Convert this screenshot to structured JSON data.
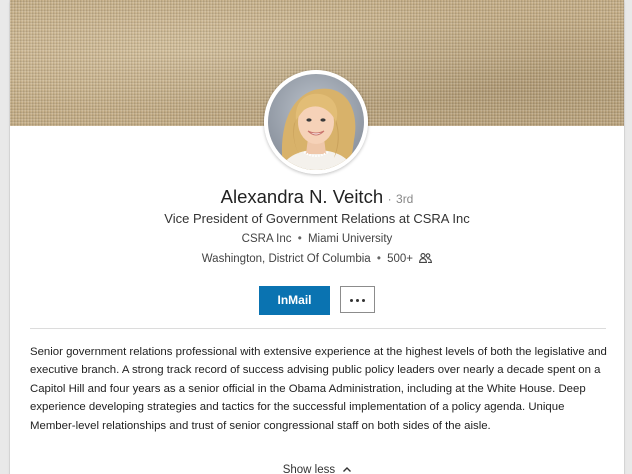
{
  "profile": {
    "name": "Alexandra N. Veitch",
    "degree_separator": "·",
    "degree": "3rd",
    "headline": "Vice President of Government Relations at CSRA Inc",
    "company": "CSRA Inc",
    "school": "Miami University",
    "location": "Washington, District Of Columbia",
    "connections": "500+",
    "separator": "•"
  },
  "actions": {
    "inmail_label": "InMail",
    "more_icon": "ellipsis-icon"
  },
  "summary": {
    "text": "Senior government relations professional with extensive experience at the highest levels of both the legislative and executive branch. A strong track record of success advising public policy leaders over nearly a decade spent on a Capitol Hill and four years as a senior official in the Obama Administration, including at the White House. Deep experience developing strategies and tactics for the successful implementation of a policy agenda. Unique Member-level relationships and trust of senior congressional staff on both sides of the aisle.",
    "toggle_label": "Show less",
    "toggle_icon": "chevron-up-icon"
  },
  "colors": {
    "primary_button": "#0a73b1",
    "banner": "#c4ad86"
  }
}
